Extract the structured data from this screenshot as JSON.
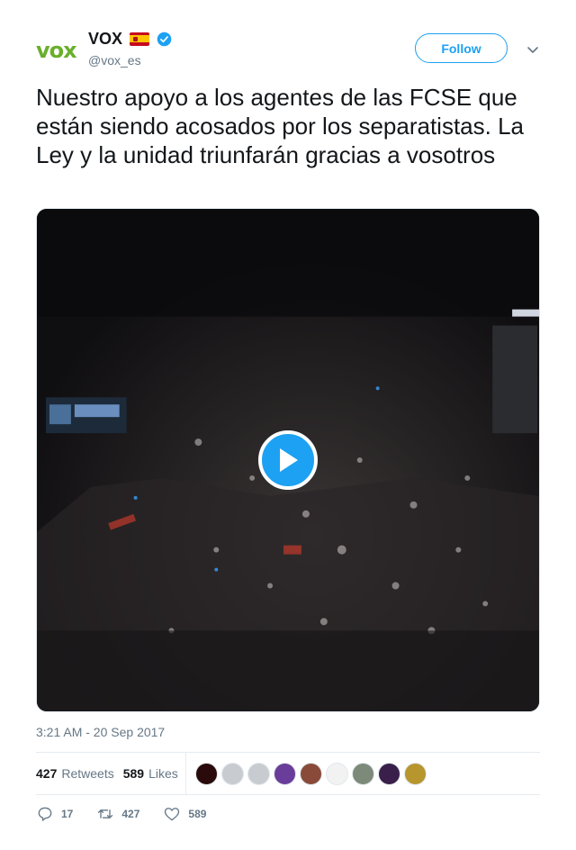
{
  "user": {
    "avatar_text": "vox",
    "display_name": "VOX",
    "handle": "@vox_es",
    "flag_icon": "spain-flag-icon",
    "verified_icon": "verified-badge-icon"
  },
  "header": {
    "follow_label": "Follow",
    "menu_icon": "chevron-down-icon"
  },
  "tweet": {
    "text": "Nuestro apoyo a los agentes de las FCSE que están siendo acosados por los separatistas. La Ley y la unidad triunfarán gracias a vosotros",
    "timestamp": "3:21 AM - 20 Sep 2017"
  },
  "media": {
    "type": "video",
    "play_icon": "play-icon"
  },
  "stats": {
    "retweets_count": "427",
    "retweets_label": "Retweets",
    "likes_count": "589",
    "likes_label": "Likes"
  },
  "likers": [
    {
      "color": "#2a0a0a"
    },
    {
      "color": "#c8ccd0"
    },
    {
      "color": "#c8ccd0"
    },
    {
      "color": "#6b3d9a"
    },
    {
      "color": "#8a4a3a"
    },
    {
      "color": "#f2f2f2"
    },
    {
      "color": "#7d8a7a"
    },
    {
      "color": "#3a1f4a"
    },
    {
      "color": "#b8962e"
    }
  ],
  "actions": {
    "reply_count": "17",
    "retweet_count": "427",
    "like_count": "589"
  },
  "colors": {
    "accent": "#1da1f2",
    "text": "#14171a",
    "muted": "#657786",
    "border": "#e6ecf0"
  }
}
